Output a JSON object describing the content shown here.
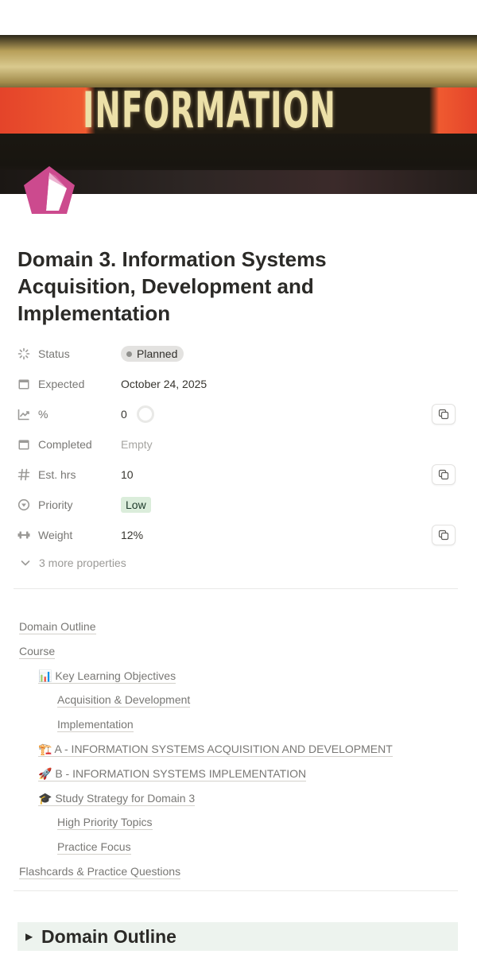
{
  "cover": {
    "sign_text": "INFORMATION"
  },
  "page": {
    "icon": "pink-pentagon-icon",
    "title": "Domain 3. Information Systems Acquisition, Development and Implementation"
  },
  "properties": [
    {
      "label": "Status",
      "icon": "status-spinner-icon",
      "value": "Planned"
    },
    {
      "label": "Expected",
      "icon": "calendar-icon",
      "value": "October 24, 2025"
    },
    {
      "label": "%",
      "icon": "chart-line-icon",
      "value": "0",
      "progress": 0
    },
    {
      "label": "Completed",
      "icon": "calendar-icon",
      "value": "Empty"
    },
    {
      "label": "Est. hrs",
      "icon": "hash-icon",
      "value": "10"
    },
    {
      "label": "Priority",
      "icon": "priority-select-icon",
      "value": "Low"
    },
    {
      "label": "Weight",
      "icon": "dumbbell-icon",
      "value": "12%"
    }
  ],
  "more_properties": "3 more properties",
  "toc": [
    {
      "text": "Domain Outline"
    },
    {
      "text": "Course"
    },
    {
      "text": "📊 Key Learning Objectives"
    },
    {
      "text": "Acquisition & Development"
    },
    {
      "text": "Implementation"
    },
    {
      "text": "🏗️ A - INFORMATION SYSTEMS ACQUISITION AND DEVELOPMENT"
    },
    {
      "text": "🚀 B - INFORMATION SYSTEMS IMPLEMENTATION"
    },
    {
      "text": "🎓 Study Strategy for Domain 3"
    },
    {
      "text": "High Priority Topics"
    },
    {
      "text": "Practice Focus"
    },
    {
      "text": "Flashcards & Practice Questions"
    }
  ],
  "toggle_heading": {
    "text": "Domain Outline"
  },
  "colors": {
    "accent_pink": "#cc4a8e",
    "status_gray": "#e3e2e0",
    "priority_green": "#dbeddb",
    "heading_bg": "#edf3ee"
  }
}
